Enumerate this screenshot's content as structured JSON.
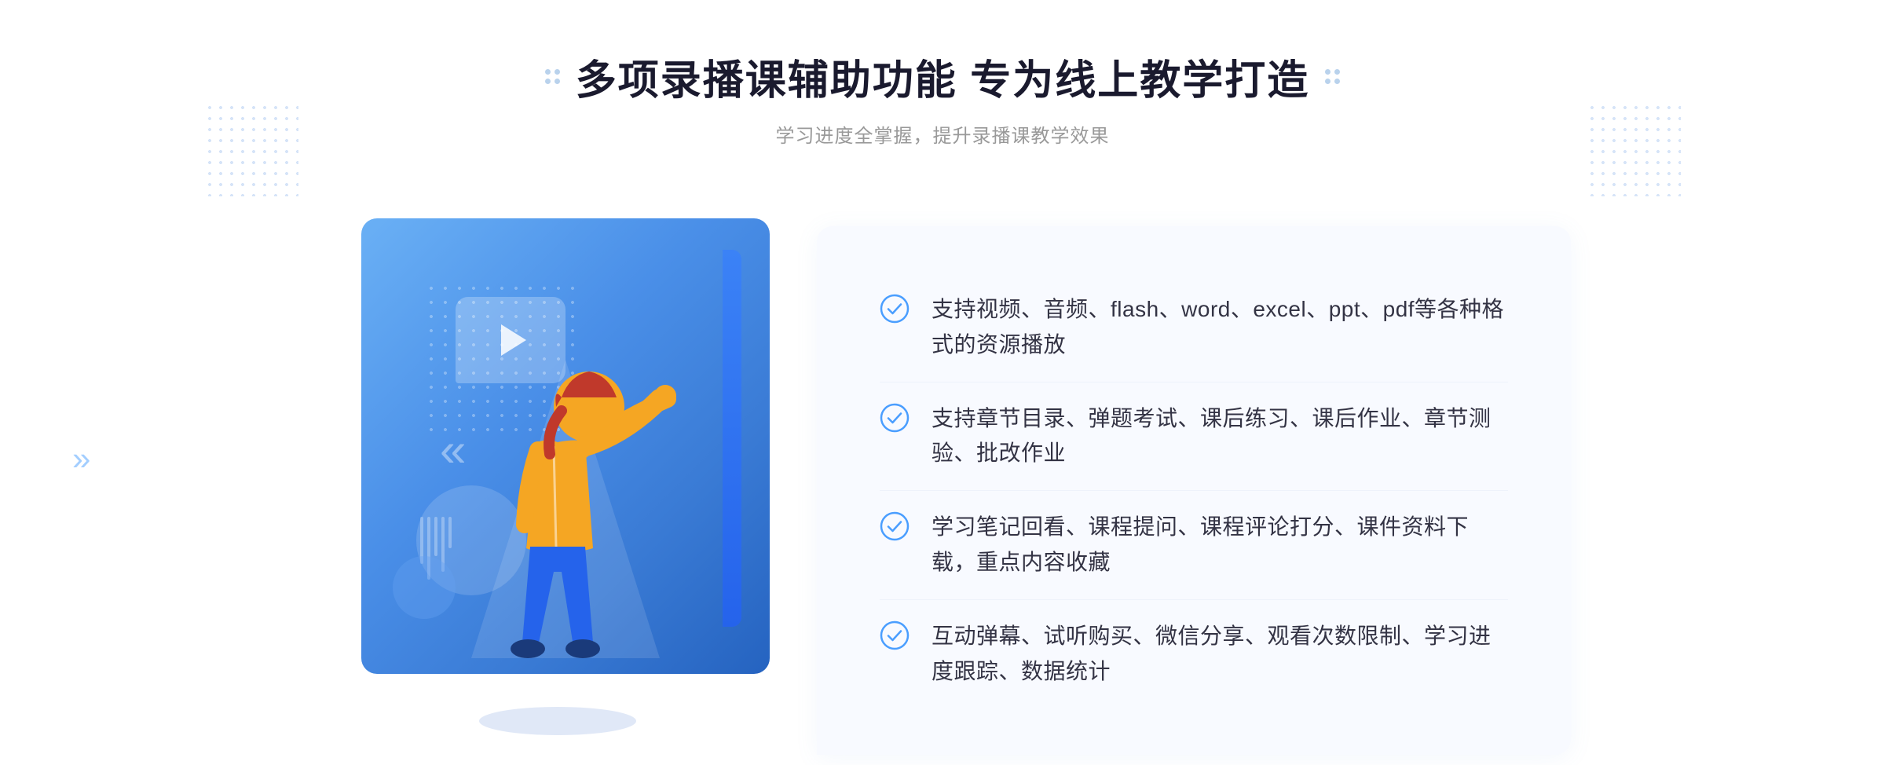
{
  "page": {
    "background_color": "#ffffff"
  },
  "header": {
    "main_title": "多项录播课辅助功能 专为线上教学打造",
    "subtitle": "学习进度全掌握，提升录播课教学效果"
  },
  "features": [
    {
      "id": 1,
      "text": "支持视频、音频、flash、word、excel、ppt、pdf等各种格式的资源播放"
    },
    {
      "id": 2,
      "text": "支持章节目录、弹题考试、课后练习、课后作业、章节测验、批改作业"
    },
    {
      "id": 3,
      "text": "学习笔记回看、课程提问、课程评论打分、课件资料下载，重点内容收藏"
    },
    {
      "id": 4,
      "text": "互动弹幕、试听购买、微信分享、观看次数限制、学习进度跟踪、数据统计"
    }
  ],
  "decoration": {
    "chevron_left": "«",
    "play_button": "▶"
  },
  "colors": {
    "primary_blue": "#3b82f6",
    "light_blue": "#6ab0f5",
    "text_dark": "#1a1a2e",
    "text_gray": "#999999",
    "feature_text": "#333344",
    "check_color": "#4a9eff"
  }
}
